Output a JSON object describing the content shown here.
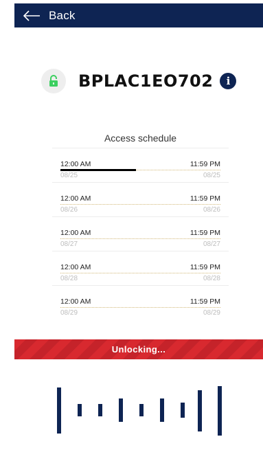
{
  "header": {
    "back_label": "Back",
    "background": "#0e2453",
    "icon": "arrow-left-icon"
  },
  "device": {
    "name": "BPLAC1EO702",
    "lock_icon": "unlocked-padlock-icon",
    "lock_color": "#3ccf60",
    "info_icon": "info-icon"
  },
  "schedule": {
    "title": "Access schedule",
    "rows": [
      {
        "start_time": "12:00 AM",
        "end_time": "11:59 PM",
        "start_date": "08/25",
        "end_date": "08/25",
        "progress": 0.47
      },
      {
        "start_time": "12:00 AM",
        "end_time": "11:59 PM",
        "start_date": "08/26",
        "end_date": "08/26",
        "progress": 0
      },
      {
        "start_time": "12:00 AM",
        "end_time": "11:59 PM",
        "start_date": "08/27",
        "end_date": "08/27",
        "progress": 0
      },
      {
        "start_time": "12:00 AM",
        "end_time": "11:59 PM",
        "start_date": "08/28",
        "end_date": "08/28",
        "progress": 0
      },
      {
        "start_time": "12:00 AM",
        "end_time": "11:59 PM",
        "start_date": "08/29",
        "end_date": "08/29",
        "progress": 0
      }
    ]
  },
  "status": {
    "label": "Unlocking...",
    "color": "#d8292f"
  },
  "signal_icon": "signal-bars-icon"
}
